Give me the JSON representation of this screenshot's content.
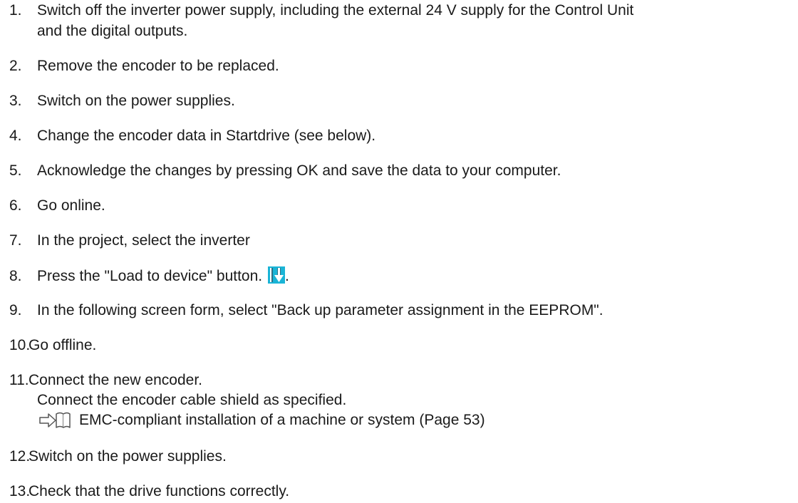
{
  "steps": [
    {
      "num": "1.",
      "text": "Switch off the inverter power supply, including the external 24 V supply for the Control Unit",
      "cont": "and the digital outputs."
    },
    {
      "num": "2.",
      "text": "Remove the encoder to be replaced."
    },
    {
      "num": "3.",
      "text": "Switch on the power supplies."
    },
    {
      "num": "4.",
      "text": "Change the encoder data in Startdrive (see below)."
    },
    {
      "num": "5.",
      "text": "Acknowledge the changes by pressing OK and save the data to your computer."
    },
    {
      "num": "6.",
      "text": "Go online."
    },
    {
      "num": "7.",
      "text": "In the project, select the inverter"
    },
    {
      "num": "8.",
      "text": "Press the \"Load to device\" button.",
      "after_icon": "."
    },
    {
      "num": "9.",
      "text": "In the following screen form, select \"Back up parameter assignment in the EEPROM\"."
    },
    {
      "num": "10.",
      "text": "Go offline."
    },
    {
      "num": "11.",
      "text": "Connect the new encoder.",
      "line2": "Connect the encoder cable shield as specified.",
      "link": "EMC-compliant installation of a machine or system (Page 53)"
    },
    {
      "num": "12.",
      "text": "Switch on the power supplies."
    },
    {
      "num": "13.",
      "text": "Check that the drive functions correctly."
    }
  ],
  "icons": {
    "load_to_device": "load-to-device-icon",
    "reference": "book-reference-icon"
  },
  "colors": {
    "text": "#1a1a1a",
    "icon_cyan": "#1ab4d6",
    "icon_dark": "#2e6f86"
  }
}
